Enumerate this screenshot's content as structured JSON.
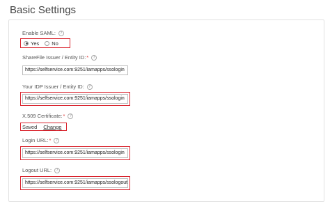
{
  "page": {
    "title": "Basic Settings"
  },
  "saml": {
    "label": "Enable SAML:",
    "options": [
      {
        "label": "Yes",
        "selected": true
      },
      {
        "label": "No",
        "selected": false
      }
    ]
  },
  "entity_id": {
    "label": "ShareFile Issuer / Entity ID:",
    "required": "*",
    "value": "https://selfservice.com:9251/iamapps/ssologin"
  },
  "idp_issuer": {
    "label": "Your IDP Issuer / Entity ID:",
    "value": "https://selfservice.com:9251/iamapps/ssologin"
  },
  "certificate": {
    "label": "X.509 Certificate:",
    "required": "*",
    "status": "Saved",
    "change_label": "Change"
  },
  "login_url": {
    "label": "Login URL:",
    "required": "*",
    "value": "https://selfservice.com:9251/iamapps/ssologin"
  },
  "logout_url": {
    "label": "Logout URL:",
    "value": "https://selfservice.com:9251/iamapps/ssologout"
  },
  "icons": {
    "help": "?"
  },
  "colors": {
    "highlight": "#d9232d",
    "border": "#bdbdbd"
  }
}
